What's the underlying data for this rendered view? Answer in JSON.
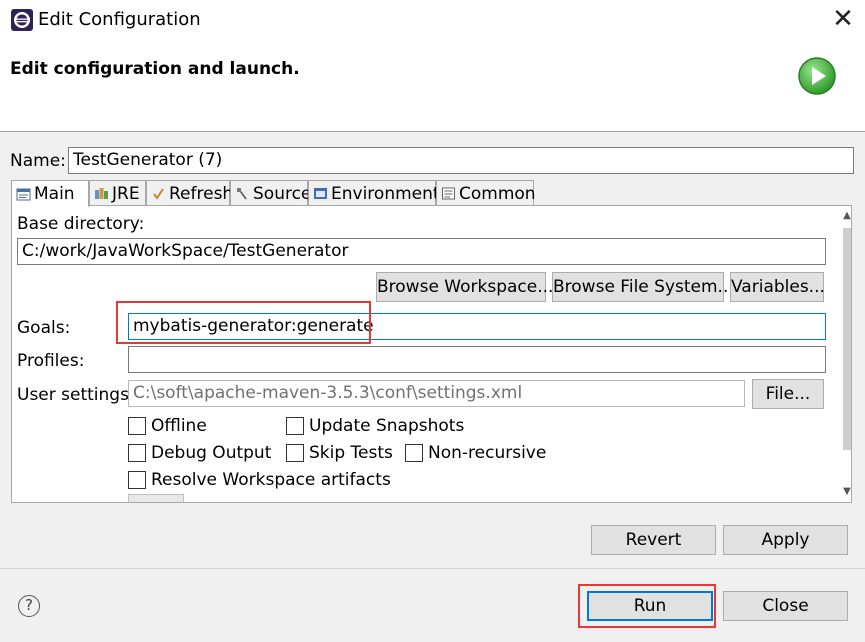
{
  "window": {
    "title": "Edit Configuration",
    "header_title": "Edit configuration and launch."
  },
  "name_field": {
    "label": "Name:",
    "value": "TestGenerator (7)"
  },
  "tabs": [
    {
      "label": "Main",
      "icon": "main-tab-icon",
      "active": true
    },
    {
      "label": "JRE",
      "icon": "jre-icon"
    },
    {
      "label": "Refresh",
      "icon": "refresh-icon"
    },
    {
      "label": "Source",
      "icon": "source-icon"
    },
    {
      "label": "Environment",
      "icon": "environment-icon"
    },
    {
      "label": "Common",
      "icon": "common-icon"
    }
  ],
  "main": {
    "base_directory_label": "Base directory:",
    "base_directory_value": "C:/work/JavaWorkSpace/TestGenerator",
    "browse_workspace_label": "Browse Workspace...",
    "browse_file_system_label": "Browse File System...",
    "variables_label": "Variables...",
    "goals_label": "Goals:",
    "goals_value": "mybatis-generator:generate",
    "profiles_label": "Profiles:",
    "profiles_value": "",
    "user_settings_label": "User settings:",
    "user_settings_value": "C:\\soft\\apache-maven-3.5.3\\conf\\settings.xml",
    "file_button_label": "File...",
    "checkboxes": {
      "offline": "Offline",
      "update_snapshots": "Update Snapshots",
      "debug_output": "Debug Output",
      "skip_tests": "Skip Tests",
      "non_recursive": "Non-recursive",
      "resolve_workspace": "Resolve Workspace artifacts"
    }
  },
  "buttons": {
    "revert": "Revert",
    "apply": "Apply",
    "run": "Run",
    "close": "Close"
  },
  "colors": {
    "accent": "#0078d7",
    "highlight": "#e53935",
    "launch_green": "#3cb043"
  }
}
